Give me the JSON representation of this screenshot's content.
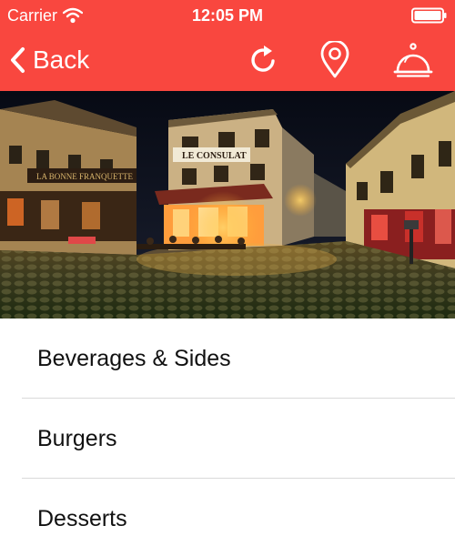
{
  "status_bar": {
    "carrier": "Carrier",
    "time": "12:05 PM",
    "wifi_icon": "wifi-icon",
    "battery_icon": "battery-icon"
  },
  "nav": {
    "back_label": "Back",
    "back_icon": "chevron-left-icon",
    "actions": [
      {
        "icon": "refresh-icon"
      },
      {
        "icon": "map-pin-icon"
      },
      {
        "icon": "service-bell-icon"
      }
    ]
  },
  "banner": {
    "sign_text": "LE CONSULAT",
    "awning_text": "LA BONNE FRANQUETTE"
  },
  "menu": {
    "items": [
      {
        "label": "Beverages & Sides"
      },
      {
        "label": "Burgers"
      },
      {
        "label": "Desserts"
      }
    ]
  },
  "colors": {
    "header": "#f9473f",
    "header_text": "#ffffff",
    "list_text": "#111111",
    "separator": "#d9d9d9"
  }
}
